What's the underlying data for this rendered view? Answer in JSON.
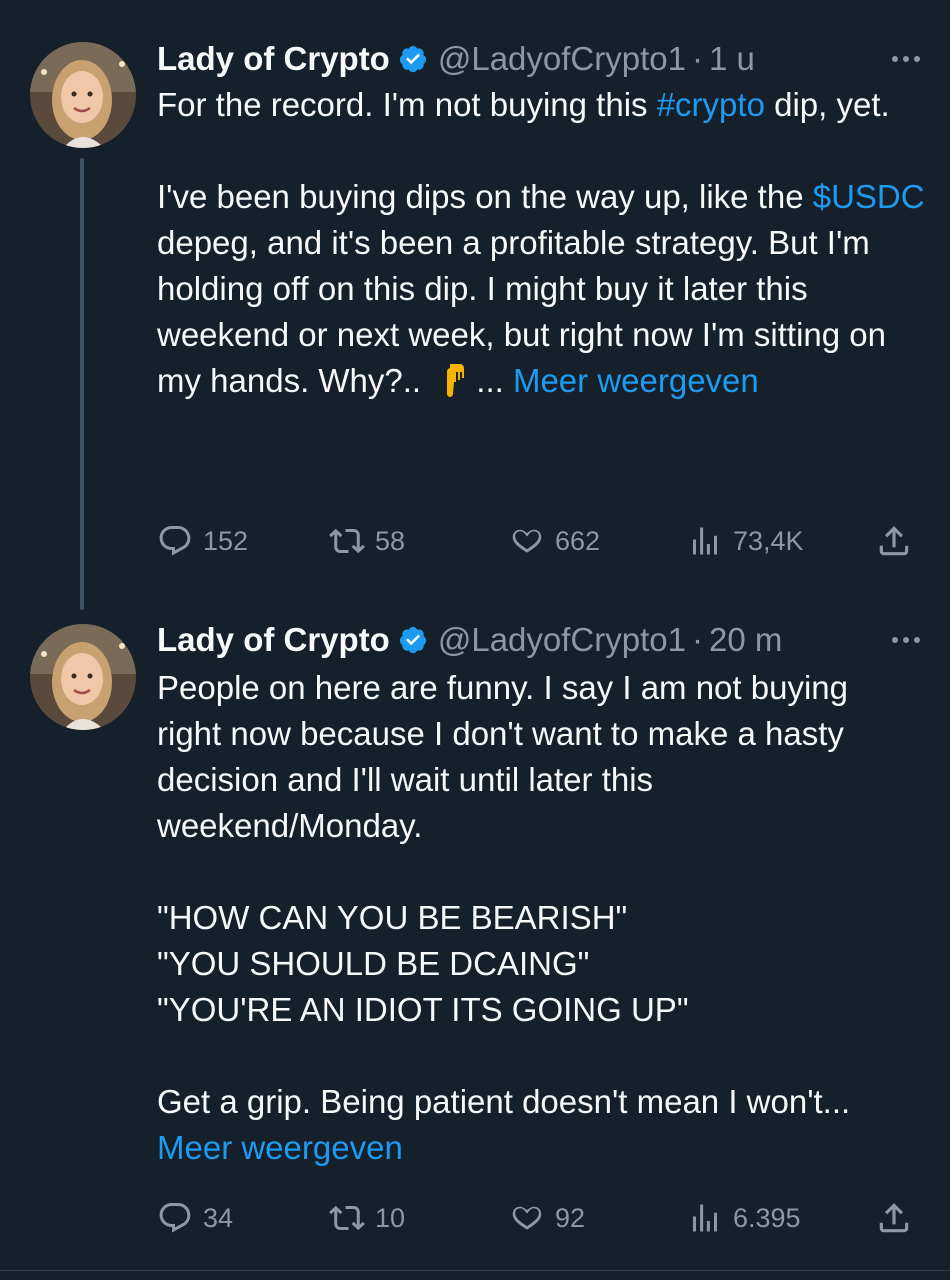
{
  "colors": {
    "background": "#15202b",
    "link": "#1d9bf0",
    "muted": "#8b98a5",
    "verified": "#1d9bf0"
  },
  "tweets": [
    {
      "author": {
        "name": "Lady of Crypto",
        "handle": "@LadyofCrypto1",
        "verified": true
      },
      "separator": "·",
      "time": "1 u",
      "body": {
        "p1_a": "For the record. I'm not buying this ",
        "p1_hashtag": "#crypto",
        "p1_b": " dip, yet.",
        "p2_a": "I've been buying dips on the way up, like the ",
        "p2_cashtag": "$USDC",
        "p2_b": " depeg, and it's been a profitable strategy. But I'm holding off on this dip. I might buy it later this weekend or next week, but right now I'm sitting on my hands. Why?..",
        "emoji": "pointing-down-icon",
        "ellipsis": "... ",
        "more": "Meer weergeven"
      },
      "stats": {
        "replies": "152",
        "retweets": "58",
        "likes": "662",
        "views": "73,4K"
      }
    },
    {
      "author": {
        "name": "Lady of Crypto",
        "handle": "@LadyofCrypto1",
        "verified": true
      },
      "separator": "·",
      "time": "20 m",
      "body": {
        "p1": "People on here are funny. I say I am not buying right now because I don't want to make a hasty decision and I'll wait until later this weekend/Monday.",
        "quote1": "\"HOW CAN YOU BE BEARISH\"",
        "quote2": "\"YOU SHOULD BE DCAING\"",
        "quote3": "\"YOU'RE AN IDIOT ITS GOING UP\"",
        "p3": "Get a grip. Being patient doesn't mean I won't... ",
        "more": "Meer weergeven"
      },
      "stats": {
        "replies": "34",
        "retweets": "10",
        "likes": "92",
        "views": "6.395"
      }
    }
  ]
}
